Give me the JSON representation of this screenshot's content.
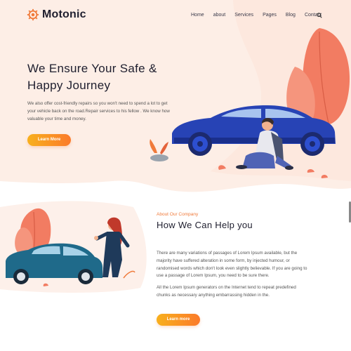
{
  "brand": {
    "name": "Motonic"
  },
  "nav": {
    "items": [
      {
        "label": "Home"
      },
      {
        "label": "about"
      },
      {
        "label": "Services"
      },
      {
        "label": "Pages"
      },
      {
        "label": "Blog"
      },
      {
        "label": "Contact"
      }
    ]
  },
  "icons": {
    "logo": "gear-icon",
    "search": "search-icon"
  },
  "hero": {
    "title_line1": "We Ensure Your Safe &",
    "title_line2": "Happy Journey",
    "description": "We also offer cost-friendly repairs so you won't need to spend a lot to get your vehicle back on the road.Repair services to his fellow . We know how valuable your time and money.",
    "button_label": "Learn More"
  },
  "about": {
    "eyebrow": "About Our Company",
    "title": "How We Can Help you",
    "paragraph1": "There are many variations of passages of Lorem Ipsum available, but the majority have suffered alteration in some form, by injected humour, or randomised words which don't look even slightly believable. If you are going to use a passage of Lorem Ipsum, you need to be sure there.",
    "paragraph2": "All the Lorem Ipsum generators on the Internet tend to repeat predefined chunks as necessary anything embarrassing hidden in the.",
    "button_label": "Learn more"
  },
  "colors": {
    "accent_orange": "#fb7a2a",
    "accent_yellow": "#f8b01d",
    "hero_bg": "#fdf0ea",
    "car_blue": "#2743b5",
    "car_teal": "#1f6a8a",
    "leaf_coral": "#f27c62"
  }
}
